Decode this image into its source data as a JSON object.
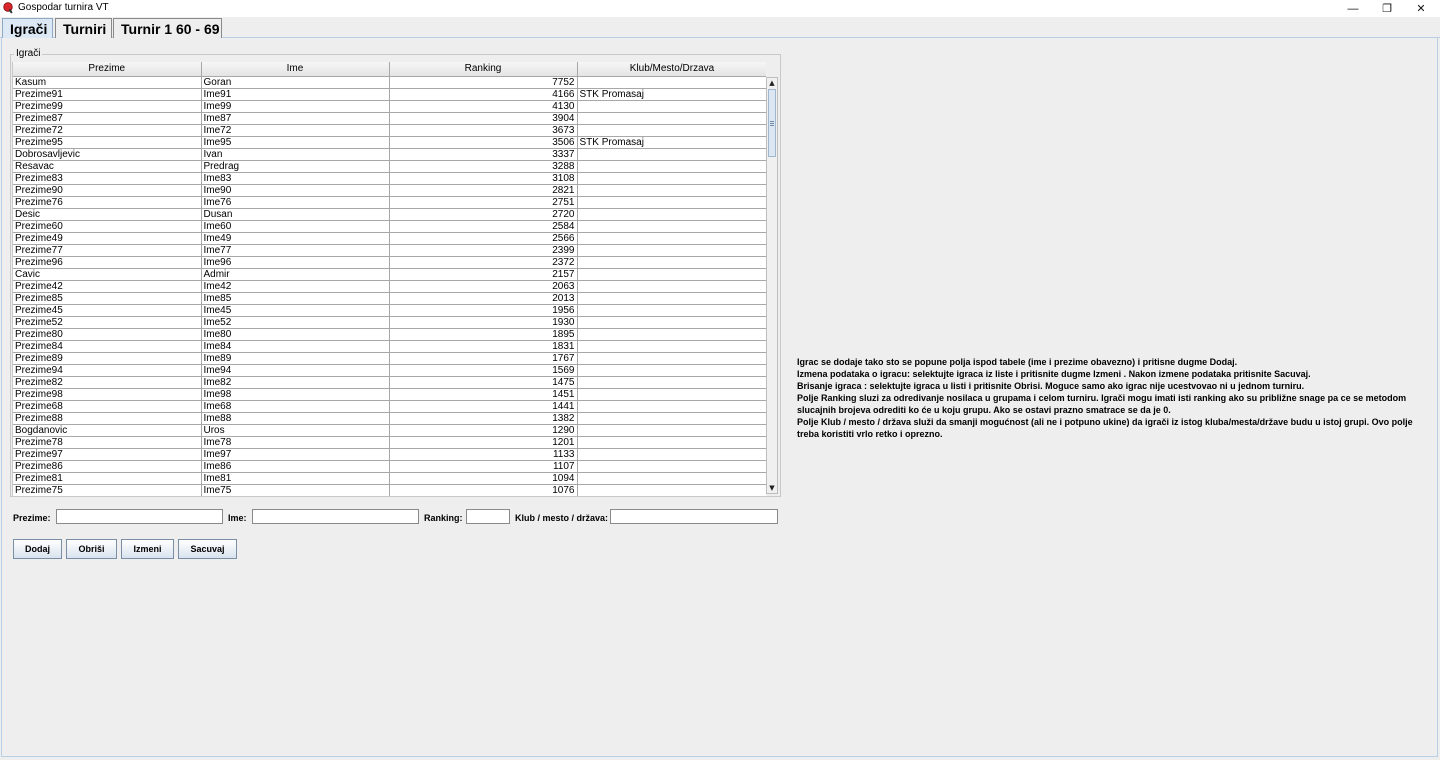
{
  "window": {
    "title": "Gospodar turnira VT",
    "minimize": "—",
    "restore": "❐",
    "close": "✕"
  },
  "tabs": [
    {
      "label": "Igrači",
      "active": true
    },
    {
      "label": "Turniri",
      "active": false
    },
    {
      "label": "Turnir 1 60 - 69",
      "active": false
    }
  ],
  "players": {
    "group_title": "Igrači",
    "columns": [
      "Prezime",
      "Ime",
      "Ranking",
      "Klub/Mesto/Drzava"
    ],
    "rows": [
      [
        "Kasum",
        "Goran",
        "7752",
        ""
      ],
      [
        "Prezime91",
        "Ime91",
        "4166",
        "STK Promasaj"
      ],
      [
        "Prezime99",
        "Ime99",
        "4130",
        ""
      ],
      [
        "Prezime87",
        "Ime87",
        "3904",
        ""
      ],
      [
        "Prezime72",
        "Ime72",
        "3673",
        ""
      ],
      [
        "Prezime95",
        "Ime95",
        "3506",
        "STK Promasaj"
      ],
      [
        "Dobrosavljevic",
        "Ivan",
        "3337",
        ""
      ],
      [
        "Resavac",
        "Predrag",
        "3288",
        ""
      ],
      [
        "Prezime83",
        "Ime83",
        "3108",
        ""
      ],
      [
        "Prezime90",
        "Ime90",
        "2821",
        ""
      ],
      [
        "Prezime76",
        "Ime76",
        "2751",
        ""
      ],
      [
        "Desic",
        "Dusan",
        "2720",
        ""
      ],
      [
        "Prezime60",
        "Ime60",
        "2584",
        ""
      ],
      [
        "Prezime49",
        "Ime49",
        "2566",
        ""
      ],
      [
        "Prezime77",
        "Ime77",
        "2399",
        ""
      ],
      [
        "Prezime96",
        "Ime96",
        "2372",
        ""
      ],
      [
        "Cavic",
        "Admir",
        "2157",
        ""
      ],
      [
        "Prezime42",
        "Ime42",
        "2063",
        ""
      ],
      [
        "Prezime85",
        "Ime85",
        "2013",
        ""
      ],
      [
        "Prezime45",
        "Ime45",
        "1956",
        ""
      ],
      [
        "Prezime52",
        "Ime52",
        "1930",
        ""
      ],
      [
        "Prezime80",
        "Ime80",
        "1895",
        ""
      ],
      [
        "Prezime84",
        "Ime84",
        "1831",
        ""
      ],
      [
        "Prezime89",
        "Ime89",
        "1767",
        ""
      ],
      [
        "Prezime94",
        "Ime94",
        "1569",
        ""
      ],
      [
        "Prezime82",
        "Ime82",
        "1475",
        ""
      ],
      [
        "Prezime98",
        "Ime98",
        "1451",
        ""
      ],
      [
        "Prezime68",
        "Ime68",
        "1441",
        ""
      ],
      [
        "Prezime88",
        "Ime88",
        "1382",
        ""
      ],
      [
        "Bogdanovic",
        "Uros",
        "1290",
        ""
      ],
      [
        "Prezime78",
        "Ime78",
        "1201",
        ""
      ],
      [
        "Prezime97",
        "Ime97",
        "1133",
        ""
      ],
      [
        "Prezime86",
        "Ime86",
        "1107",
        ""
      ],
      [
        "Prezime81",
        "Ime81",
        "1094",
        ""
      ],
      [
        "Prezime75",
        "Ime75",
        "1076",
        ""
      ]
    ]
  },
  "form": {
    "prezime_label": "Prezime:",
    "prezime_value": "",
    "ime_label": "Ime:",
    "ime_value": "",
    "ranking_label": "Ranking:",
    "ranking_value": "",
    "klub_label": "Klub / mesto / država:",
    "klub_value": ""
  },
  "buttons": {
    "add": "Dodaj",
    "delete": "Obriši",
    "edit": "Izmeni",
    "save": "Sacuvaj"
  },
  "help": {
    "lines": [
      "Igrac se dodaje tako sto se popune polja ispod tabele (ime i prezime obavezno) i pritisne dugme Dodaj.",
      "Izmena podataka o igracu: selektujte igraca iz liste i pritisnite dugme Izmeni . Nakon izmene podataka pritisnite Sacuvaj.",
      "Brisanje igraca : selektujte igraca u listi i pritisnite Obrisi. Moguce samo ako igrac nije ucestvovao ni u jednom turniru.",
      "Polje Ranking sluzi za odredivanje nosilaca u grupama i celom turniru. Igrači mogu imati isti ranking ako su približne snage pa ce se metodom slucajnih brojeva odrediti ko će u koju grupu. Ako se ostavi prazno smatrace se da je 0.",
      "Polje Klub / mesto / država služi da smanji mogućnost (ali ne i potpuno ukine) da igrači iz istog kluba/mesta/države budu u istoj grupi. Ovo polje treba koristiti vrlo retko i oprezno."
    ]
  },
  "colors": {
    "background": "#eeeeee",
    "active_tab": "#dce8f4",
    "grid": "#a8a8a8"
  }
}
